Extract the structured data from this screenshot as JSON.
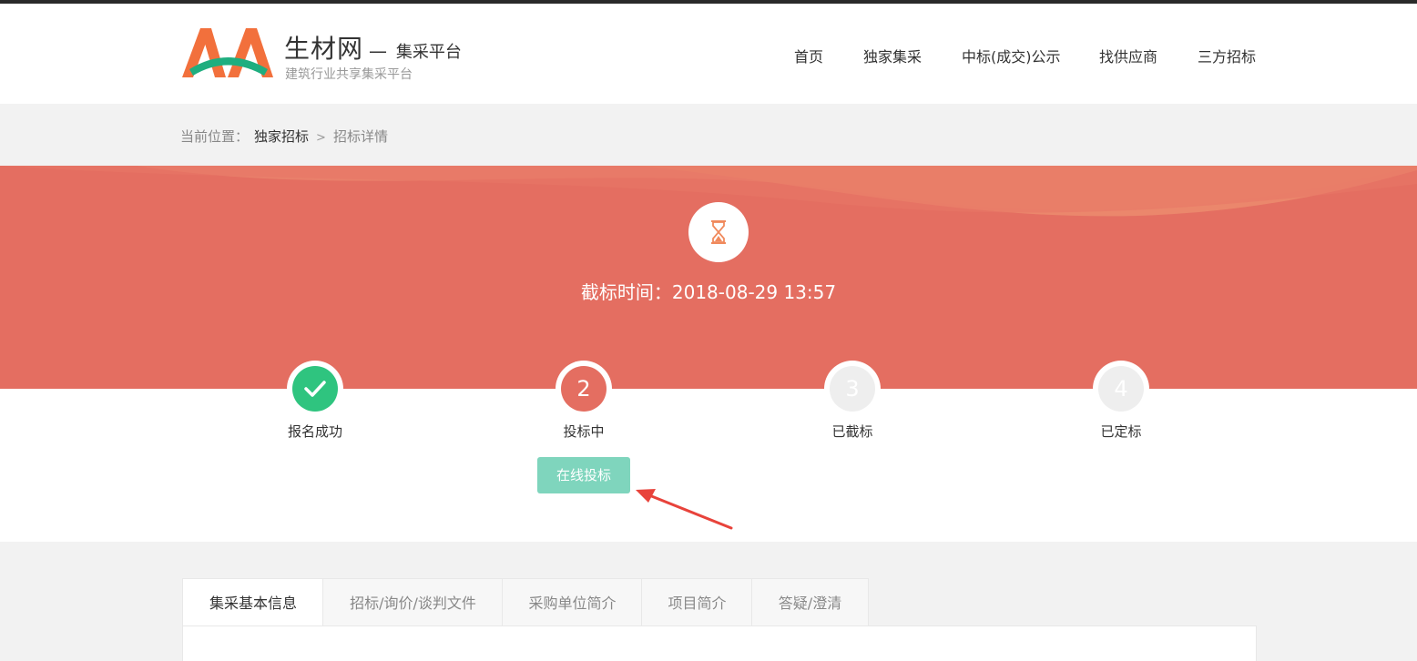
{
  "header": {
    "brand_name": "生材网",
    "brand_sep": "—",
    "brand_sub": "集采平台",
    "slogan": "建筑行业共享集采平台",
    "nav": [
      "首页",
      "独家集采",
      "中标(成交)公示",
      "找供应商",
      "三方招标"
    ]
  },
  "breadcrumb": {
    "prefix": "当前位置：",
    "items": [
      "独家招标",
      "招标详情"
    ],
    "separator": ">"
  },
  "banner": {
    "icon": "hourglass-icon",
    "deadline": "截标时间：2018-08-29 13:57",
    "color": "#e46e61"
  },
  "steps": [
    {
      "symbol": "✓",
      "label": "报名成功",
      "state": "done",
      "color": "#2fc47f"
    },
    {
      "symbol": "2",
      "label": "投标中",
      "state": "current",
      "color": "#e46e61"
    },
    {
      "symbol": "3",
      "label": "已截标",
      "state": "pending",
      "color": "#eeeeee"
    },
    {
      "symbol": "4",
      "label": "已定标",
      "state": "pending",
      "color": "#eeeeee"
    }
  ],
  "action": {
    "bid_label": "在线投标",
    "color": "#7fd5bd"
  },
  "tabs": [
    {
      "label": "集采基本信息",
      "active": true
    },
    {
      "label": "招标/询价/谈判文件",
      "active": false
    },
    {
      "label": "采购单位简介",
      "active": false
    },
    {
      "label": "项目简介",
      "active": false
    },
    {
      "label": "答疑/澄清",
      "active": false
    }
  ]
}
